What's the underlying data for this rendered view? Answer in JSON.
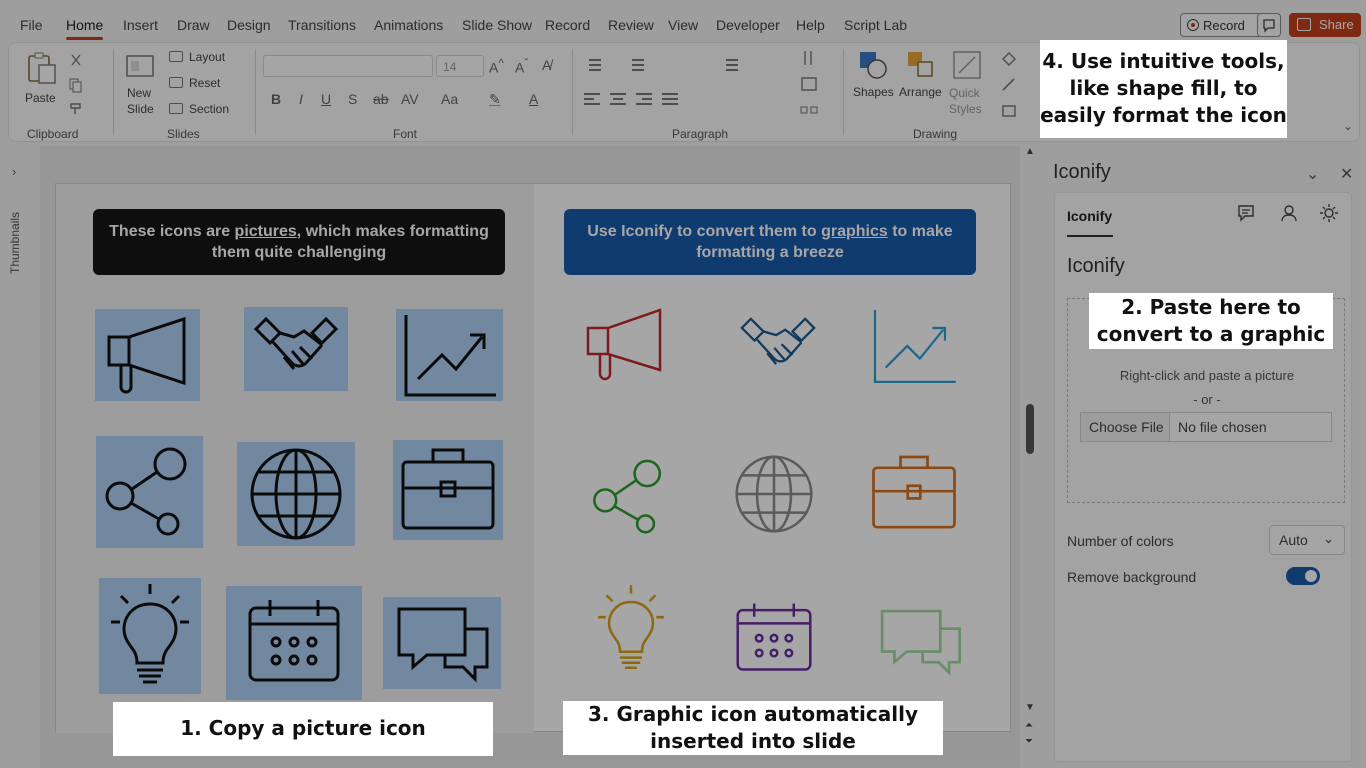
{
  "menubar": {
    "items": [
      "File",
      "Home",
      "Insert",
      "Draw",
      "Design",
      "Transitions",
      "Animations",
      "Slide Show",
      "Record",
      "Review",
      "View",
      "Developer",
      "Help",
      "Script Lab"
    ],
    "active": "Home",
    "record_label": "Record",
    "share_label": "Share"
  },
  "ribbon": {
    "paste_label": "Paste",
    "new_slide_label": "New\nSlide",
    "layout_label": "Layout",
    "reset_label": "Reset",
    "section_label": "Section",
    "shapes_label": "Shapes",
    "arrange_label": "Arrange",
    "quick_styles_label": "Quick\nStyles",
    "font_size": "14",
    "groups": [
      "Clipboard",
      "Slides",
      "Font",
      "Paragraph",
      "Drawing"
    ]
  },
  "thumbnails": {
    "label": "Thumbnails"
  },
  "slide": {
    "left_caption_prefix": "These icons are ",
    "left_caption_link": "pictures",
    "left_caption_suffix": ", which makes formatting them quite challenging",
    "right_caption_prefix": "Use Iconify to convert them to ",
    "right_caption_link": "graphics",
    "right_caption_suffix": " to make formatting a breeze",
    "icons": [
      "megaphone-icon",
      "handshake-icon",
      "chart-up-icon",
      "share-icon",
      "globe-icon",
      "briefcase-icon",
      "lightbulb-icon",
      "calendar-icon",
      "chat-icon"
    ],
    "graphic_colors": [
      "#c0282d",
      "#1e5a8c",
      "#2f9fd8",
      "#2e9b2e",
      "#8c8c8c",
      "#d9701f",
      "#d9a21c",
      "#6b2fa0",
      "#9edb9e"
    ]
  },
  "pane": {
    "title": "Iconify",
    "tab_label": "Iconify",
    "heading": "Iconify",
    "dropzone_text": "Right-click and paste a picture",
    "or_text": "- or -",
    "choose_file": "Choose File",
    "no_file": "No file chosen",
    "num_colors_label": "Number of colors",
    "num_colors_value": "Auto",
    "remove_bg_label": "Remove background",
    "remove_bg_on": true
  },
  "callouts": {
    "step1": "1. Copy a picture icon",
    "step2": "2. Paste here to convert to a graphic",
    "step3": "3. Graphic icon automatically inserted into slide",
    "step4": "4. Use intuitive tools, like shape fill, to easily format the icon"
  }
}
